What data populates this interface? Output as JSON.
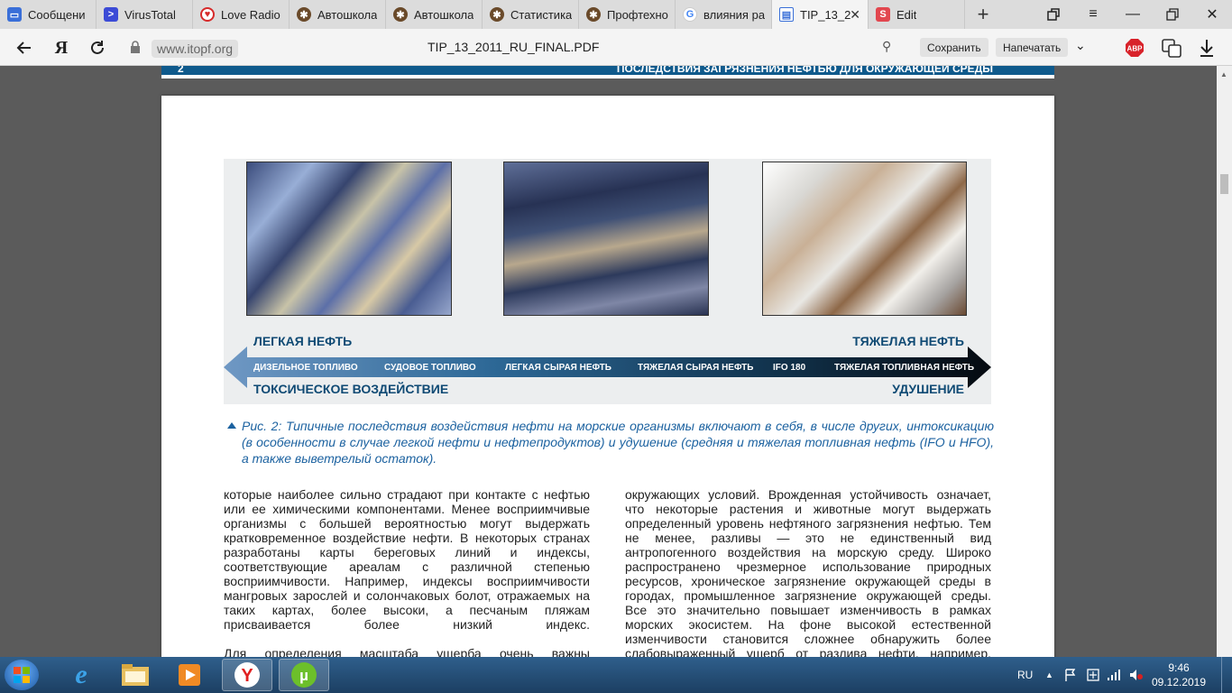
{
  "browser": {
    "tabs": [
      {
        "title": "Сообщени",
        "icon": "chat-icon",
        "color": "#3a6fd8"
      },
      {
        "title": "VirusTotal",
        "icon": "virustotal-icon",
        "color": "#3c4bd6"
      },
      {
        "title": "Love Radio",
        "icon": "loveradio-icon",
        "color": "#d62a2a"
      },
      {
        "title": "Автошкола",
        "icon": "wheel-icon",
        "color": "#6a4a2a"
      },
      {
        "title": "Автошкола",
        "icon": "wheel-icon",
        "color": "#6a4a2a"
      },
      {
        "title": "Статистика",
        "icon": "wheel-icon",
        "color": "#6a4a2a"
      },
      {
        "title": "Профтехно",
        "icon": "wheel-icon",
        "color": "#6a4a2a"
      },
      {
        "title": "влияния ра",
        "icon": "google-icon",
        "color": "#4285f4"
      },
      {
        "title": "TIP_13_2",
        "icon": "pdf-icon",
        "color": "#3a6fd8",
        "active": true
      },
      {
        "title": "Edit",
        "icon": "s-icon",
        "color": "#e2474f"
      }
    ],
    "url_domain": "www.itopf.org",
    "doc_title": "TIP_13_2011_RU_FINAL.PDF",
    "save_label": "Сохранить",
    "print_label": "Напечатать",
    "abp_label": "ABP"
  },
  "pdf": {
    "prev_page_number": "2",
    "prev_page_header": "ПОСЛЕДСТВИЯ ЗАГРЯЗНЕНИЯ НЕФТЬЮ ДЛЯ ОКРУЖАЮЩЕЙ СРЕДЫ",
    "figure": {
      "top_left": "ЛЕГКАЯ НЕФТЬ",
      "top_right": "ТЯЖЕЛАЯ НЕФТЬ",
      "bottom_left": "ТОКСИЧЕСКОЕ ВОЗДЕЙСТВИЕ",
      "bottom_right": "УДУШЕНИЕ",
      "scale": [
        "ДИЗЕЛЬНОЕ ТОПЛИВО",
        "СУДОВОЕ ТОПЛИВО",
        "ЛЕГКАЯ СЫРАЯ НЕФТЬ",
        "ТЯЖЕЛАЯ СЫРАЯ НЕФТЬ",
        "IFO 180",
        "ТЯЖЕЛАЯ ТОПЛИВНАЯ НЕФТЬ"
      ]
    },
    "caption": "Рис. 2: Типичные последствия воздействия нефти на морские организмы включают в себя, в числе других, интоксикацию (в особенности в случае легкой нефти и нефтепродуктов) и удушение (средняя и тяжелая топливная нефть (IFO и HFO), а также выветрелый остаток).",
    "left_column": [
      "которые наиболее сильно страдают при контакте с нефтью или ее химическими компонентами. Менее восприимчивые организмы с большей вероятностью могут выдержать кратковременное воздействие нефти. В некоторых странах разработаны карты береговых линий и индексы, соответствующие ареалам с различной степенью восприимчивости. Например, индексы восприимчивости мангровых зарослей и солончаковых болот, отражаемых на таких картах, более высоки, а песчаным пляжам присваивается более низкий индекс.",
      "Для определения масштаба ущерба очень важны"
    ],
    "right_column": [
      "окружающих условий. Врожденная устойчивость означает, что некоторые растения и животные могут выдержать определенный уровень нефтяного загрязнения нефтью. Тем не менее, разливы — это не единственный вид антропогенного воздействия на морскую среду. Широко распространено чрезмерное использование природных ресурсов, хроническое загрязнение окружающей среды в городах, промышленное загрязнение окружающей среды. Все это значительно повышает изменчивость в рамках морских экосистем. На фоне высокой естественной изменчивости становится сложнее обнаружить более слабовыраженный ущерб от разлива нефти, например,"
    ]
  },
  "taskbar": {
    "apps": [
      "ie-icon",
      "explorer-icon",
      "media-player-icon",
      "yandex-browser-icon",
      "utorrent-icon"
    ],
    "lang": "RU",
    "time": "9:46",
    "date": "09.12.2019"
  }
}
